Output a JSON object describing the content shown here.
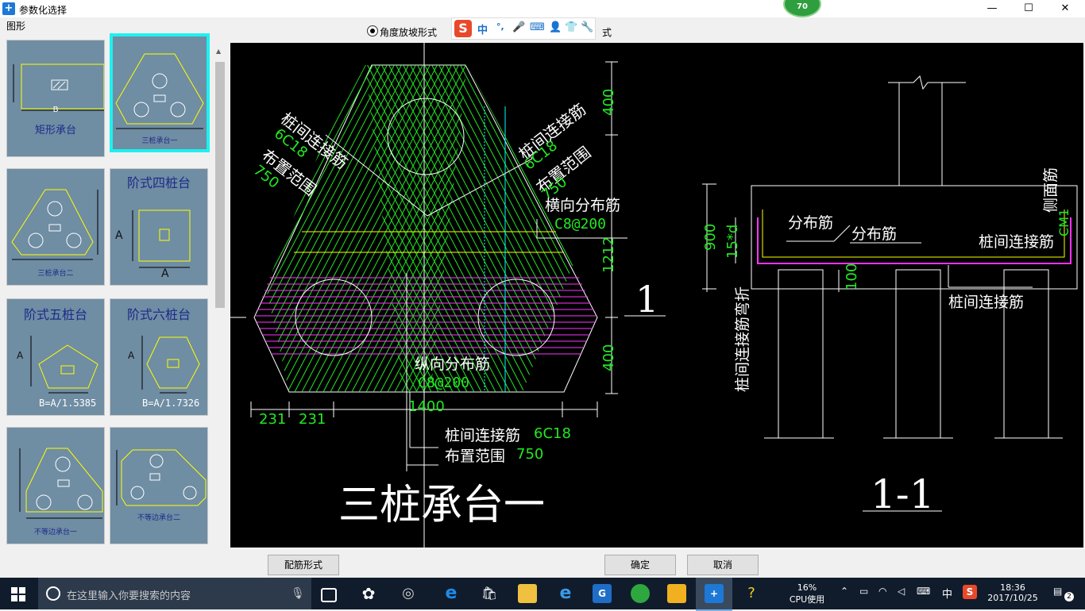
{
  "window": {
    "title": "参数化选择",
    "minimize": "—",
    "maximize": "☐",
    "close": "✕",
    "badge": "70"
  },
  "left_panel": {
    "label": "图形",
    "thumbnails": [
      {
        "caption": "矩形承台",
        "dim": "B"
      },
      {
        "caption": "三桩承台一",
        "selected": true
      },
      {
        "caption": "三桩承台二"
      },
      {
        "caption": "阶式四桩台",
        "dim_a": "A",
        "dim_b": "A"
      },
      {
        "caption": "阶式五桩台",
        "dim_a": "A",
        "formula": "B=A/1.5385"
      },
      {
        "caption": "阶式六桩台",
        "dim_a": "A",
        "formula": "B=A/1.7326"
      },
      {
        "caption": "不等边承台一"
      },
      {
        "caption": "不等边承台二"
      }
    ]
  },
  "top_options": {
    "radio1": "角度放坡形式",
    "radio2_suffix": "式"
  },
  "ime": {
    "lang": "中",
    "punct": "°,"
  },
  "drawing": {
    "left": {
      "title": "三桩承台一",
      "label_tl_1": "桩间连接筋",
      "label_tl_2": "6C18",
      "label_tl_3": "布置范围",
      "label_tl_4": "750",
      "label_tr_1": "桩间连接筋",
      "label_tr_2": "6C18",
      "label_tr_3": "布置范围",
      "label_tr_4": "750",
      "label_h_1": "横向分布筋",
      "label_h_2": "C8@200",
      "label_v_1": "纵向分布筋",
      "label_v_2": "C8@200",
      "label_b_1": "桩间连接筋",
      "label_b_2": "6C18",
      "label_b_3": "布置范围",
      "label_b_4": "750",
      "dim_400_top": "400",
      "dim_1212": "1212",
      "dim_400_bot": "400",
      "dim_231a": "231",
      "dim_231b": "231",
      "dim_1400": "1400",
      "section_mark": "1"
    },
    "right": {
      "title": "1-1",
      "label_fb1": "分布筋",
      "label_fb2": "分布筋",
      "label_side": "侧面筋",
      "label_cm": "CM1",
      "label_conn1": "桩间连接筋",
      "label_conn2": "桩间连接筋",
      "label_bend": "桩间连接筋弯折",
      "dim_900": "900",
      "dim_15d": "15*d",
      "dim_100": "100"
    }
  },
  "bottom": {
    "btn_rebar": "配筋形式",
    "btn_ok": "确定",
    "btn_cancel": "取消"
  },
  "taskbar": {
    "search_placeholder": "在这里输入你要搜索的内容",
    "cpu_percent": "16%",
    "cpu_label": "CPU使用",
    "ime_lang": "中",
    "time": "18:36",
    "date": "2017/10/25",
    "notifications": "2"
  },
  "colors": {
    "green": "#22e822",
    "yellow": "#ffff00",
    "magenta": "#ff33ff",
    "cyan": "#00ffff",
    "thumb_bg": "#6f8da3"
  }
}
